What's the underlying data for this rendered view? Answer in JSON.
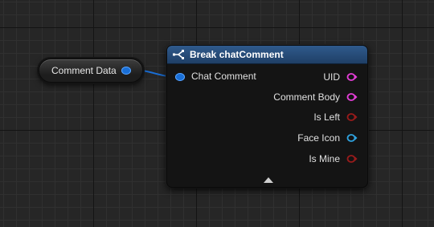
{
  "graph": {
    "variable_node": {
      "label": "Comment Data",
      "pin_color": "#1a6fd6"
    },
    "break_node": {
      "title": "Break chatComment",
      "header_color": "#2f5a8c",
      "input_pin": {
        "label": "Chat Comment",
        "color": "#1a6fd6"
      },
      "output_pins": [
        {
          "label": "UID",
          "color": "#e53ed8",
          "icon": "string-pin-icon"
        },
        {
          "label": "Comment Body",
          "color": "#e53ed8",
          "icon": "string-pin-icon"
        },
        {
          "label": "Is Left",
          "color": "#9a1b1b",
          "icon": "bool-pin-icon"
        },
        {
          "label": "Face Icon",
          "color": "#2fa3e0",
          "icon": "object-pin-icon"
        },
        {
          "label": "Is Mine",
          "color": "#9a1b1b",
          "icon": "bool-pin-icon"
        }
      ],
      "expand_icon": "collapse-arrow-icon"
    },
    "connection_color": "#1a6fd6"
  }
}
